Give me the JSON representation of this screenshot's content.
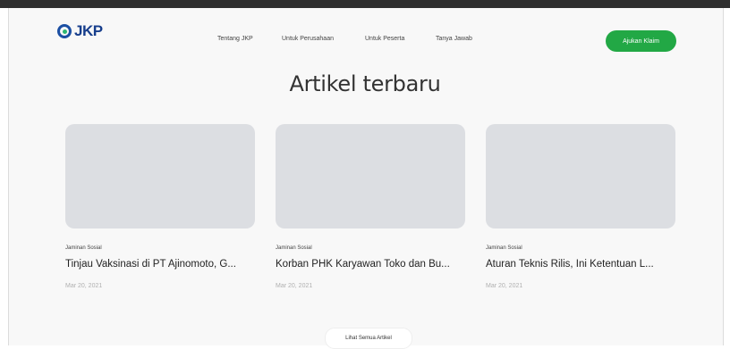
{
  "header": {
    "logo_text": "JKP",
    "nav": [
      "Tentang JKP",
      "Untuk Perusahaan",
      "Untuk Peserta",
      "Tanya Jawab"
    ],
    "cta_label": "Ajukan Klaim"
  },
  "section": {
    "title": "Artikel terbaru",
    "see_all_label": "Lihat Semua Artikel"
  },
  "articles": [
    {
      "category": "Jaminan Sosial",
      "title": "Tinjau Vaksinasi di PT Ajinomoto, G...",
      "date": "Mar 20, 2021"
    },
    {
      "category": "Jaminan Sosial",
      "title": "Korban PHK Karyawan Toko dan Bu...",
      "date": "Mar 20, 2021"
    },
    {
      "category": "Jaminan Sosial",
      "title": "Aturan Teknis Rilis, Ini Ketentuan L...",
      "date": "Mar 20, 2021"
    }
  ],
  "colors": {
    "brand_blue": "#173e8c",
    "cta_green": "#22a845",
    "placeholder_gray": "#dcdee2"
  }
}
